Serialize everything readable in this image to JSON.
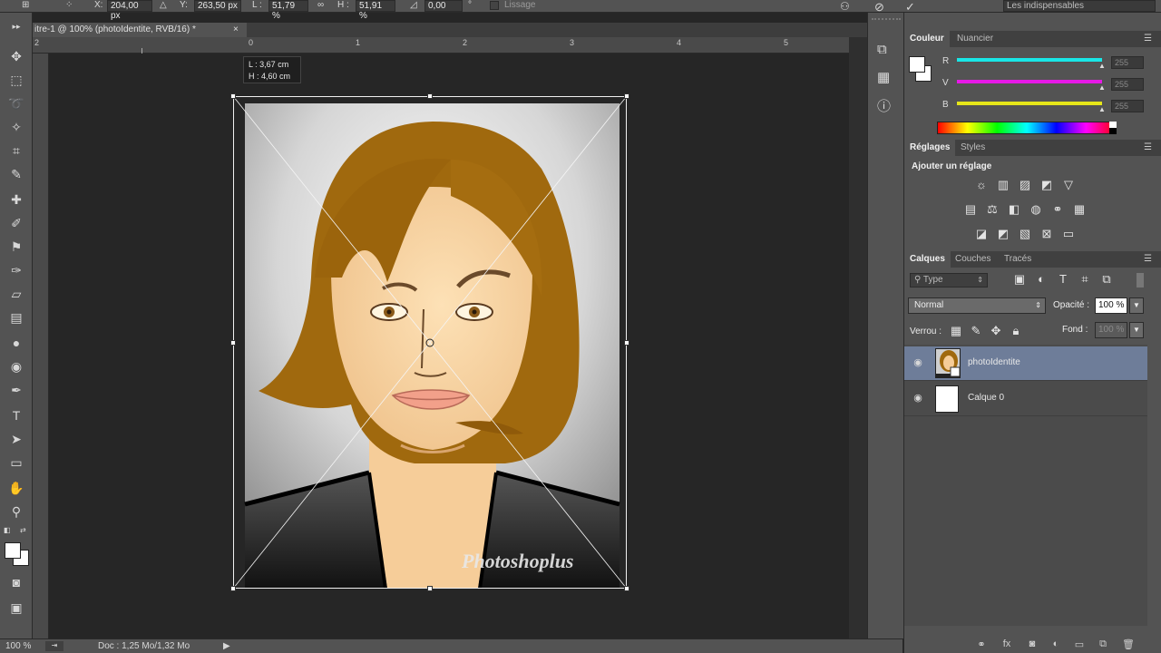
{
  "options_bar": {
    "x_label": "X:",
    "x_value": "204,00 px",
    "y_label": "Y:",
    "y_value": "263,50 px",
    "w_label": "L :",
    "w_value": "51,79 %",
    "h_label": "H :",
    "h_value": "51,91 %",
    "angle_value": "0,00",
    "angle_unit": "°",
    "smoothing_label": "Lissage",
    "workspace_label": "Les indispensables"
  },
  "document_tab": {
    "title": "itre-1 @ 100% (photoIdentite, RVB/16) *",
    "close": "×"
  },
  "ruler": {
    "h_ticks": [
      "2",
      "0",
      "1",
      "2",
      "3",
      "4",
      "5"
    ]
  },
  "transform_tooltip": {
    "width": "L :  3,67 cm",
    "height": "H :  4,60 cm"
  },
  "watermark": "Photoshoplus",
  "status_bar": {
    "zoom": "100 %",
    "doc_info": "Doc : 1,25 Mo/1,32 Mo"
  },
  "color_panel": {
    "tabs": [
      "Couleur",
      "Nuancier"
    ],
    "channels": [
      {
        "label": "R",
        "value": "255",
        "color": "#19e6e6"
      },
      {
        "label": "V",
        "value": "255",
        "color": "#e619e6"
      },
      {
        "label": "B",
        "value": "255",
        "color": "#e6e619"
      }
    ]
  },
  "adjust_panel": {
    "tabs": [
      "Réglages",
      "Styles"
    ],
    "title": "Ajouter un réglage",
    "row1": [
      "brightness-icon",
      "levels-icon",
      "curves-icon",
      "exposure-icon",
      "gradient-triangle-icon"
    ],
    "row2": [
      "vibrance-icon",
      "balance-icon",
      "bw-icon",
      "photo-filter-icon",
      "channel-mixer-icon",
      "lookup-icon"
    ],
    "row3": [
      "invert-icon",
      "posterize-icon",
      "threshold-icon",
      "selective-icon",
      "gradient-map-icon"
    ]
  },
  "layers_panel": {
    "tabs": [
      "Calques",
      "Couches",
      "Tracés"
    ],
    "filter_label": "Type",
    "blend_mode": "Normal",
    "opacity_label": "Opacité :",
    "opacity_value": "100 %",
    "lock_label": "Verrou :",
    "fill_label": "Fond :",
    "fill_value": "100 %",
    "layers": [
      {
        "name": "photoIdentite",
        "selected": true
      },
      {
        "name": "Calque 0",
        "selected": false
      }
    ]
  },
  "colors": {
    "selected_layer": "#6e7d99",
    "panel_bg": "#535353",
    "canvas_bg": "#262626"
  }
}
